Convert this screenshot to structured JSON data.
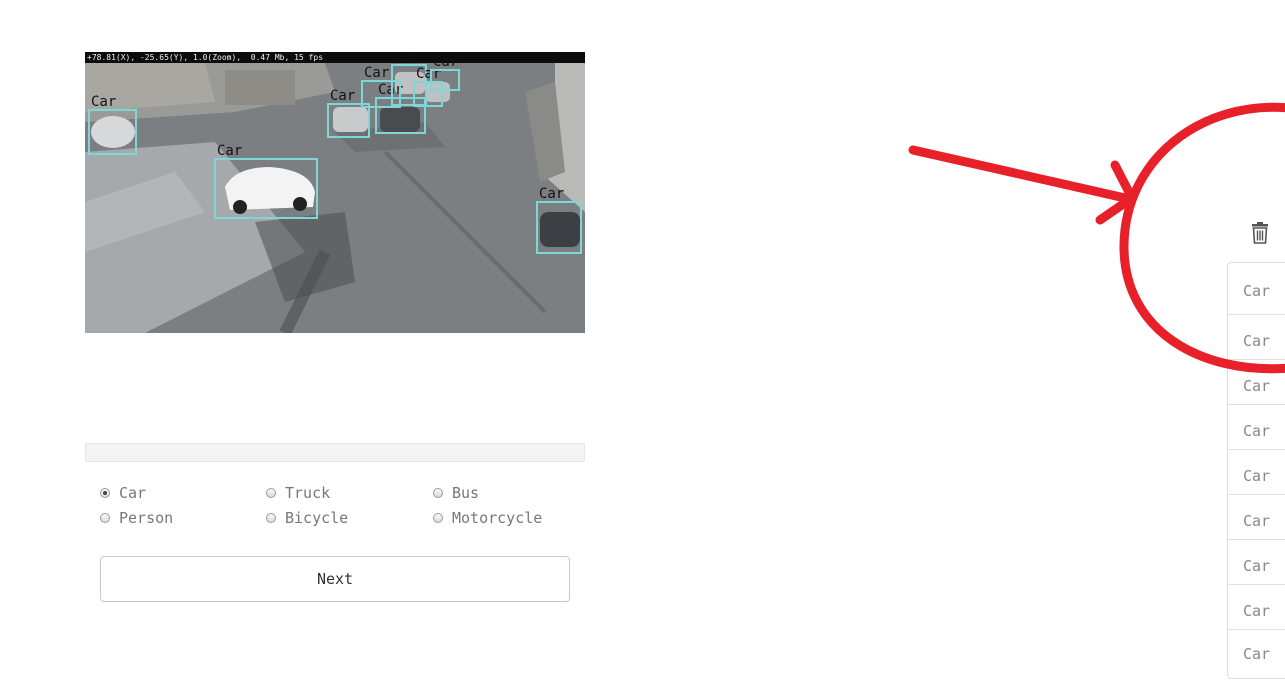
{
  "camera": {
    "status_text": "+78.81(X), -25.65(Y), 1.0(Zoom),  0.47 Mb, 15 fps",
    "detections": [
      {
        "label": "Car"
      },
      {
        "label": "Car"
      },
      {
        "label": "Car"
      },
      {
        "label": "Car"
      },
      {
        "label": "Car"
      },
      {
        "label": "Car"
      },
      {
        "label": "Car"
      },
      {
        "label": "Car"
      },
      {
        "label": "Car"
      }
    ]
  },
  "progress": {
    "fraction": 0.0
  },
  "classes": [
    {
      "label": "Car",
      "selected": true
    },
    {
      "label": "Truck",
      "selected": false
    },
    {
      "label": "Bus",
      "selected": false
    },
    {
      "label": "Person",
      "selected": false
    },
    {
      "label": "Bicycle",
      "selected": false
    },
    {
      "label": "Motorcycle",
      "selected": false
    }
  ],
  "next_button_label": "Next",
  "sidebar": {
    "trash_icon": "trash-icon",
    "labels": [
      "Car",
      "Car",
      "Car",
      "Car",
      "Car",
      "Car",
      "Car",
      "Car",
      "Car"
    ]
  },
  "colors": {
    "bbox": "#7fd6d6",
    "annotation_red": "#e8202a"
  }
}
